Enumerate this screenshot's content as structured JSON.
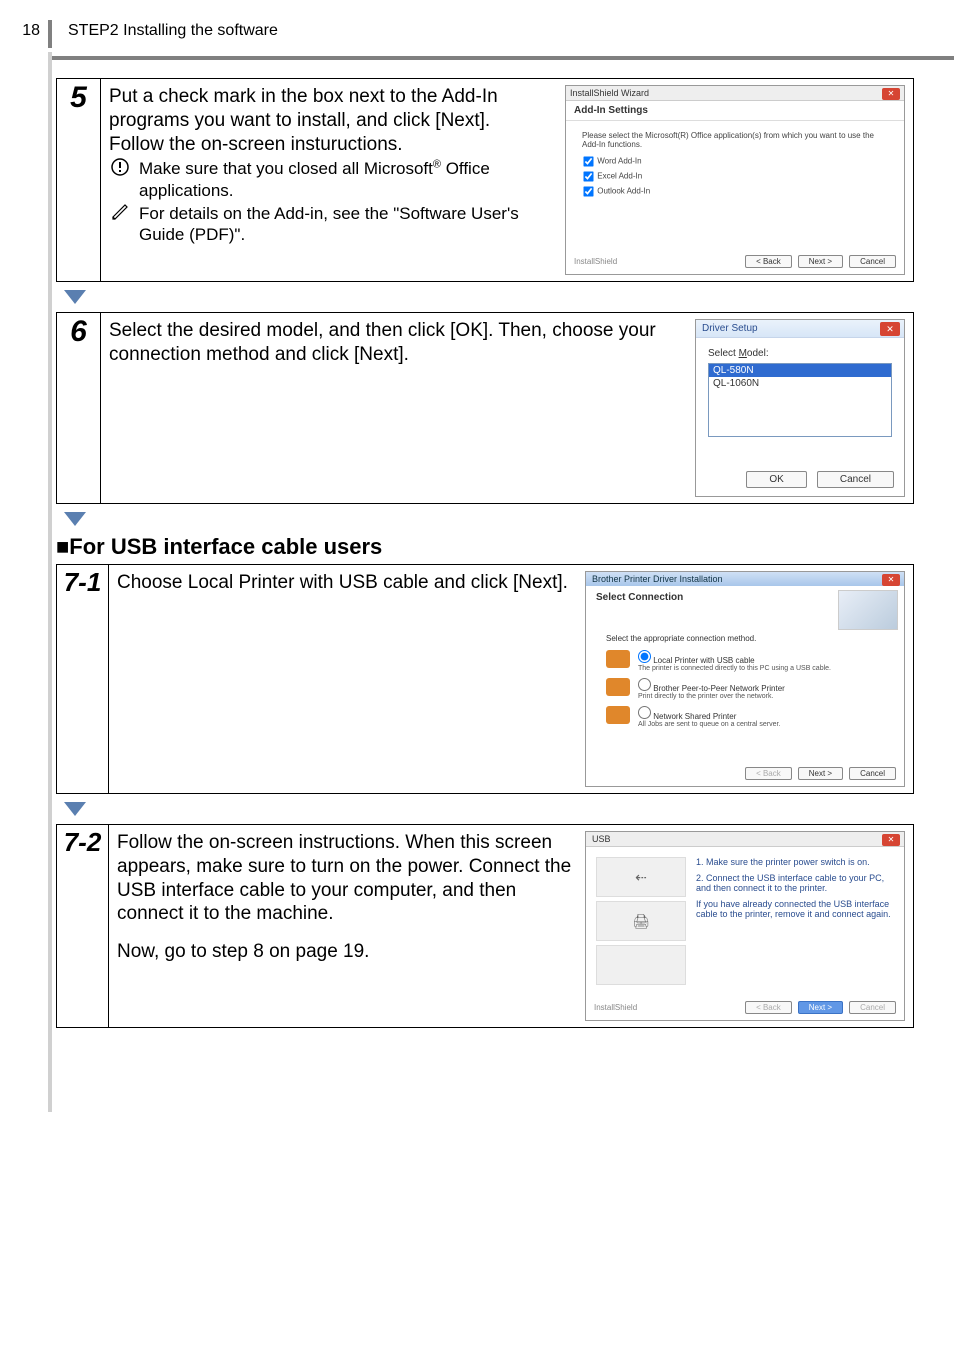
{
  "header": {
    "page_number": "18",
    "title": "STEP2 Installing the software"
  },
  "step5": {
    "num": "5",
    "p1": "Put a check mark in the box next to the Add-In programs you want to install, and click [Next].",
    "p2": "Follow the on-screen instuructions.",
    "note1": "Make sure that you closed all Microsoft",
    "note1_suffix": " Office applications.",
    "note2": "For details on the Add-in, see the \"Software User's Guide (PDF)\".",
    "shot": {
      "title": "InstallShield Wizard",
      "heading": "Add-In Settings",
      "prompt": "Please select the Microsoft(R) Office application(s) from which you want to use the Add-In functions.",
      "opt1": "Word Add-In",
      "opt2": "Excel Add-In",
      "opt3": "Outlook Add-In",
      "brand": "InstallShield",
      "back": "< Back",
      "next": "Next >",
      "cancel": "Cancel"
    }
  },
  "step6": {
    "num": "6",
    "p1": "Select the desired model, and then click [OK]. Then, choose your connection method and click [Next].",
    "shot": {
      "title": "Driver Setup",
      "label": "Select Model:",
      "m1": "QL-580N",
      "m2": "QL-1060N",
      "ok": "OK",
      "cancel": "Cancel"
    }
  },
  "section_usb": "■For USB interface cable users",
  "step71": {
    "num": "7-1",
    "p1": "Choose Local Printer with USB cable and click [Next].",
    "shot": {
      "title": "Brother Printer Driver Installation",
      "heading": "Select Connection",
      "prompt": "Select the appropriate connection method.",
      "o1": "Local Printer with USB cable",
      "o1s": "The printer is connected directly to this PC using a USB cable.",
      "o2": "Brother Peer-to-Peer Network Printer",
      "o2s": "Print directly to the printer over the network.",
      "o3": "Network Shared Printer",
      "o3s": "All Jobs are sent to queue on a central server.",
      "back": "< Back",
      "next": "Next >",
      "cancel": "Cancel"
    }
  },
  "step72": {
    "num": "7-2",
    "p1": "Follow the on-screen instructions. When this screen appears, make sure to turn on the power. Connect the USB interface cable to your computer, and then connect it to the machine.",
    "p2": "Now, go to step 8 on page 19.",
    "shot": {
      "title": "USB",
      "t1": "1. Make sure the printer power switch is on.",
      "t2": "2. Connect the USB interface cable to your PC, and then connect it to the printer.",
      "t3": "If you have already connected the USB interface cable to the printer, remove it and connect again.",
      "brand": "InstallShield",
      "back": "< Back",
      "next": "Next >",
      "cancel": "Cancel"
    }
  }
}
